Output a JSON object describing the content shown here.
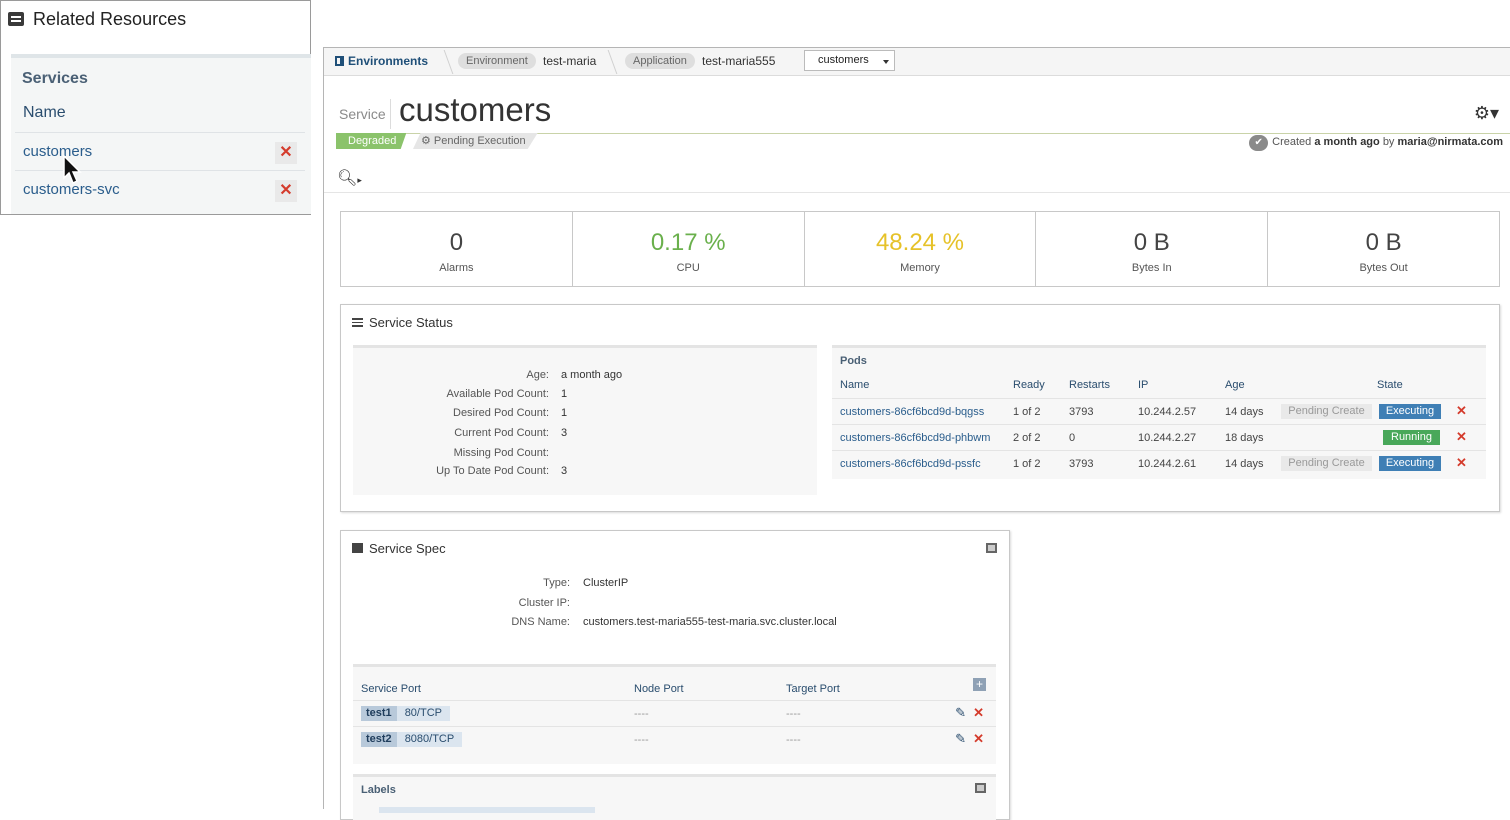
{
  "related": {
    "title": "Related Resources",
    "section": "Services",
    "column_name": "Name",
    "items": [
      {
        "name": "customers",
        "remove": "✕"
      },
      {
        "name": "customers-svc",
        "remove": "✕"
      }
    ]
  },
  "topbar": {
    "environments_label": "Environments",
    "env_label": "Environment",
    "env_value": "test-maria",
    "app_label": "Application",
    "app_value": "test-maria555",
    "selected_service": "customers"
  },
  "header": {
    "kind": "Service",
    "title": "customers",
    "status": "Degraded",
    "pending": "Pending Execution",
    "created_prefix": "Created",
    "created_when": "a month ago",
    "created_by_word": "by",
    "created_by": "maria@nirmata.com"
  },
  "metrics": [
    {
      "value": "0",
      "label": "Alarms",
      "color": "#444444"
    },
    {
      "value": "0.17 %",
      "label": "CPU",
      "color": "#6ab04c"
    },
    {
      "value": "48.24 %",
      "label": "Memory",
      "color": "#e6c229"
    },
    {
      "value": "0 B",
      "label": "Bytes In",
      "color": "#444444"
    },
    {
      "value": "0 B",
      "label": "Bytes Out",
      "color": "#444444"
    }
  ],
  "service_status": {
    "title": "Service Status",
    "fields": [
      {
        "key": "Age:",
        "value": "a month ago"
      },
      {
        "key": "Available Pod Count:",
        "value": "1"
      },
      {
        "key": "Desired Pod Count:",
        "value": "1"
      },
      {
        "key": "Current Pod Count:",
        "value": "3"
      },
      {
        "key": "Missing Pod Count:",
        "value": ""
      },
      {
        "key": "Up To Date Pod Count:",
        "value": "3"
      }
    ],
    "pods": {
      "title": "Pods",
      "headers": {
        "name": "Name",
        "ready": "Ready",
        "restarts": "Restarts",
        "ip": "IP",
        "age": "Age",
        "state": "State"
      },
      "rows": [
        {
          "name": "customers-86cf6bcd9d-bqgss",
          "ready": "1 of 2",
          "restarts": "3793",
          "ip": "10.244.2.57",
          "age": "14 days",
          "pending": "Pending Create",
          "state": "Executing"
        },
        {
          "name": "customers-86cf6bcd9d-phbwm",
          "ready": "2 of 2",
          "restarts": "0",
          "ip": "10.244.2.27",
          "age": "18 days",
          "pending": "",
          "state": "Running"
        },
        {
          "name": "customers-86cf6bcd9d-pssfc",
          "ready": "1 of 2",
          "restarts": "3793",
          "ip": "10.244.2.61",
          "age": "14 days",
          "pending": "Pending Create",
          "state": "Executing"
        }
      ]
    }
  },
  "service_spec": {
    "title": "Service Spec",
    "fields": [
      {
        "key": "Type:",
        "value": "ClusterIP"
      },
      {
        "key": "Cluster IP:",
        "value": ""
      },
      {
        "key": "DNS Name:",
        "value": "customers.test-maria555-test-maria.svc.cluster.local"
      }
    ],
    "ports": {
      "headers": {
        "service_port": "Service Port",
        "node_port": "Node Port",
        "target_port": "Target Port"
      },
      "rows": [
        {
          "name": "test1",
          "port": "80/TCP",
          "node": "----",
          "target": "----"
        },
        {
          "name": "test2",
          "port": "8080/TCP",
          "node": "----",
          "target": "----"
        }
      ]
    },
    "labels_title": "Labels"
  }
}
